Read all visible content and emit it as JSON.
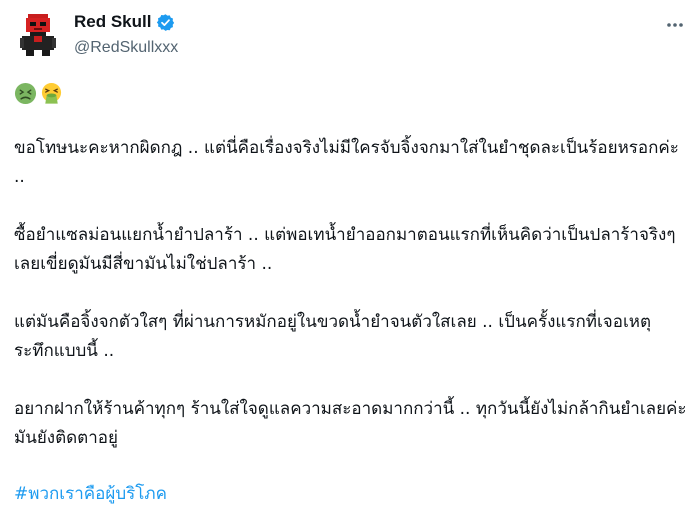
{
  "post": {
    "author": {
      "display_name": "Red Skull",
      "handle": "@RedSkullxxx",
      "verified": true,
      "avatar_icon": "red-skull-pixel-avatar-icon"
    },
    "more_icon": "ellipsis-icon",
    "emoji": [
      "nauseated-face-icon",
      "vomiting-face-icon"
    ],
    "paragraphs": [
      "ขอโทษนะคะหากผิดกฎ .. แต่นี่คือเรื่องจริงไม่มีใครจับจิ้งจกมาใส่ในยำชุดละเป็นร้อยหรอกค่ะ ..",
      "ซื้อยำแซลม่อนแยกน้ำยำปลาร้า .. แต่พอเทน้ำยำออกมาตอนแรกที่เห็นคิดว่าเป็นปลาร้าจริงๆ เลยเขี่ยดูมันมีสี่ขามันไม่ใช่ปลาร้า ..",
      "แต่มันคือจิ้งจกตัวใสๆ ที่ผ่านการหมักอยู่ในขวดน้ำยำจนตัวใสเลย .. เป็นครั้งแรกที่เจอเหตุระทึกแบบนี้ ..",
      "อยากฝากให้ร้านค้าทุกๆ ร้านใส่ใจดูแลความสะอาดมากกว่านี้ .. ทุกวันนี้ยังไม่กล้ากินยำเลยค่ะมันยังติดตาอยู่"
    ],
    "hashtag": "#พวกเราคือผู้บริโภค",
    "colors": {
      "text": "#0f1419",
      "secondary": "#536471",
      "link": "#1d9bf0",
      "verified": "#1d9bf0"
    }
  }
}
